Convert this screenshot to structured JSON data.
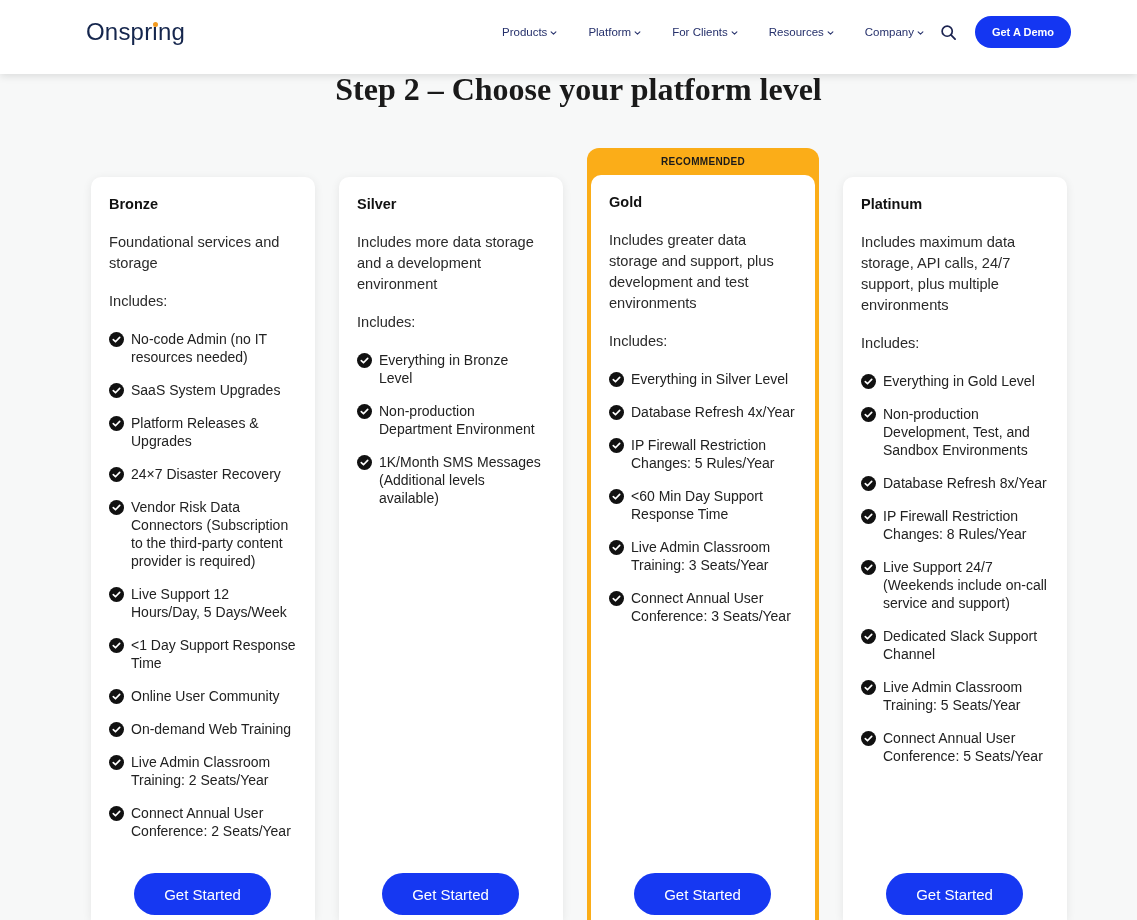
{
  "header": {
    "logo": "Onspring",
    "nav": [
      {
        "label": "Products",
        "dropdown": true
      },
      {
        "label": "Platform",
        "dropdown": true
      },
      {
        "label": "For Clients",
        "dropdown": true
      },
      {
        "label": "Resources",
        "dropdown": true
      },
      {
        "label": "Company",
        "dropdown": true
      }
    ],
    "cta": "Get A Demo"
  },
  "title": "Step 2 – Choose your platform level",
  "plans": [
    {
      "name": "Bronze",
      "recommended": false,
      "description": "Foundational services and storage",
      "includes_label": "Includes:",
      "features": [
        "No-code Admin (no IT resources needed)",
        "SaaS System Upgrades",
        "Platform Releases & Upgrades",
        "24×7 Disaster Recovery",
        "Vendor Risk Data Connectors (Subscription to the third-party content provider is required)",
        "Live Support 12 Hours/Day, 5 Days/Week",
        "<1 Day Support Response Time",
        "Online User Community",
        "On-demand Web Training",
        "Live Admin Classroom Training: 2 Seats/Year",
        "Connect Annual User Conference: 2 Seats/Year"
      ],
      "button": "Get Started"
    },
    {
      "name": "Silver",
      "recommended": false,
      "description": "Includes more data storage and a development environment",
      "includes_label": "Includes:",
      "features": [
        "Everything in Bronze Level",
        "Non-production Department Environment",
        "1K/Month SMS Messages (Additional levels available)"
      ],
      "button": "Get Started"
    },
    {
      "name": "Gold",
      "recommended": true,
      "badge": "RECOMMENDED",
      "description": "Includes greater data storage and support, plus development and test environments",
      "includes_label": "Includes:",
      "features": [
        "Everything in Silver Level",
        "Database Refresh 4x/Year",
        "IP Firewall Restriction Changes: 5 Rules/Year",
        "<60 Min Day Support Response Time",
        "Live Admin Classroom Training: 3 Seats/Year",
        "Connect Annual User Conference: 3 Seats/Year"
      ],
      "button": "Get Started"
    },
    {
      "name": "Platinum",
      "recommended": false,
      "description": "Includes maximum data storage, API calls, 24/7 support, plus multiple environments",
      "includes_label": "Includes:",
      "features": [
        "Everything in Gold Level",
        "Non-production Development, Test, and Sandbox Environments",
        "Database Refresh 8x/Year",
        "IP Firewall Restriction Changes: 8 Rules/Year",
        "Live Support 24/7 (Weekends include on-call service and support)",
        "Dedicated Slack Support Channel",
        "Live Admin Classroom Training: 5 Seats/Year",
        "Connect Annual User Conference: 5 Seats/Year"
      ],
      "button": "Get Started"
    }
  ]
}
